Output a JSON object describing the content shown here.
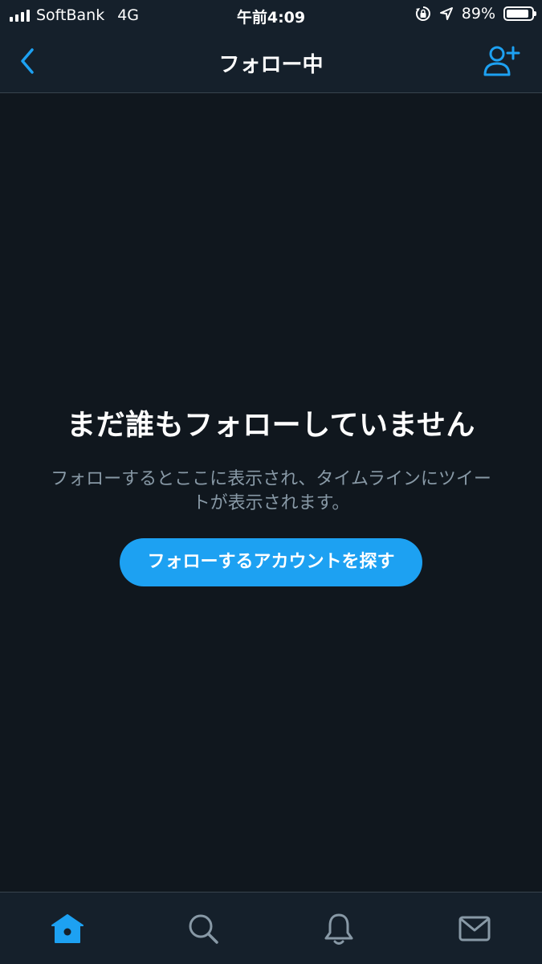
{
  "status_bar": {
    "carrier": "SoftBank",
    "network": "4G",
    "time": "午前4:09",
    "battery_percent_label": "89%",
    "battery_level": 0.89,
    "icons": [
      "signal-bars-icon",
      "orientation-lock-icon",
      "location-arrow-icon",
      "battery-icon"
    ]
  },
  "nav": {
    "title": "フォロー中",
    "back_icon": "chevron-left-icon",
    "add_user_icon": "add-user-icon"
  },
  "empty_state": {
    "title": "まだ誰もフォローしていません",
    "description": "フォローするとここに表示され、タイムラインにツイートが表示されます。",
    "button_label": "フォローするアカウントを探す"
  },
  "tab_bar": {
    "tabs": [
      {
        "icon": "home-icon",
        "active": true
      },
      {
        "icon": "search-icon",
        "active": false
      },
      {
        "icon": "bell-icon",
        "active": false
      },
      {
        "icon": "mail-icon",
        "active": false
      }
    ]
  },
  "colors": {
    "accent": "#1da1f2",
    "background": "#10171e",
    "bar_background": "#15202b",
    "secondary_text": "#8899a6",
    "divider": "#38444d"
  }
}
